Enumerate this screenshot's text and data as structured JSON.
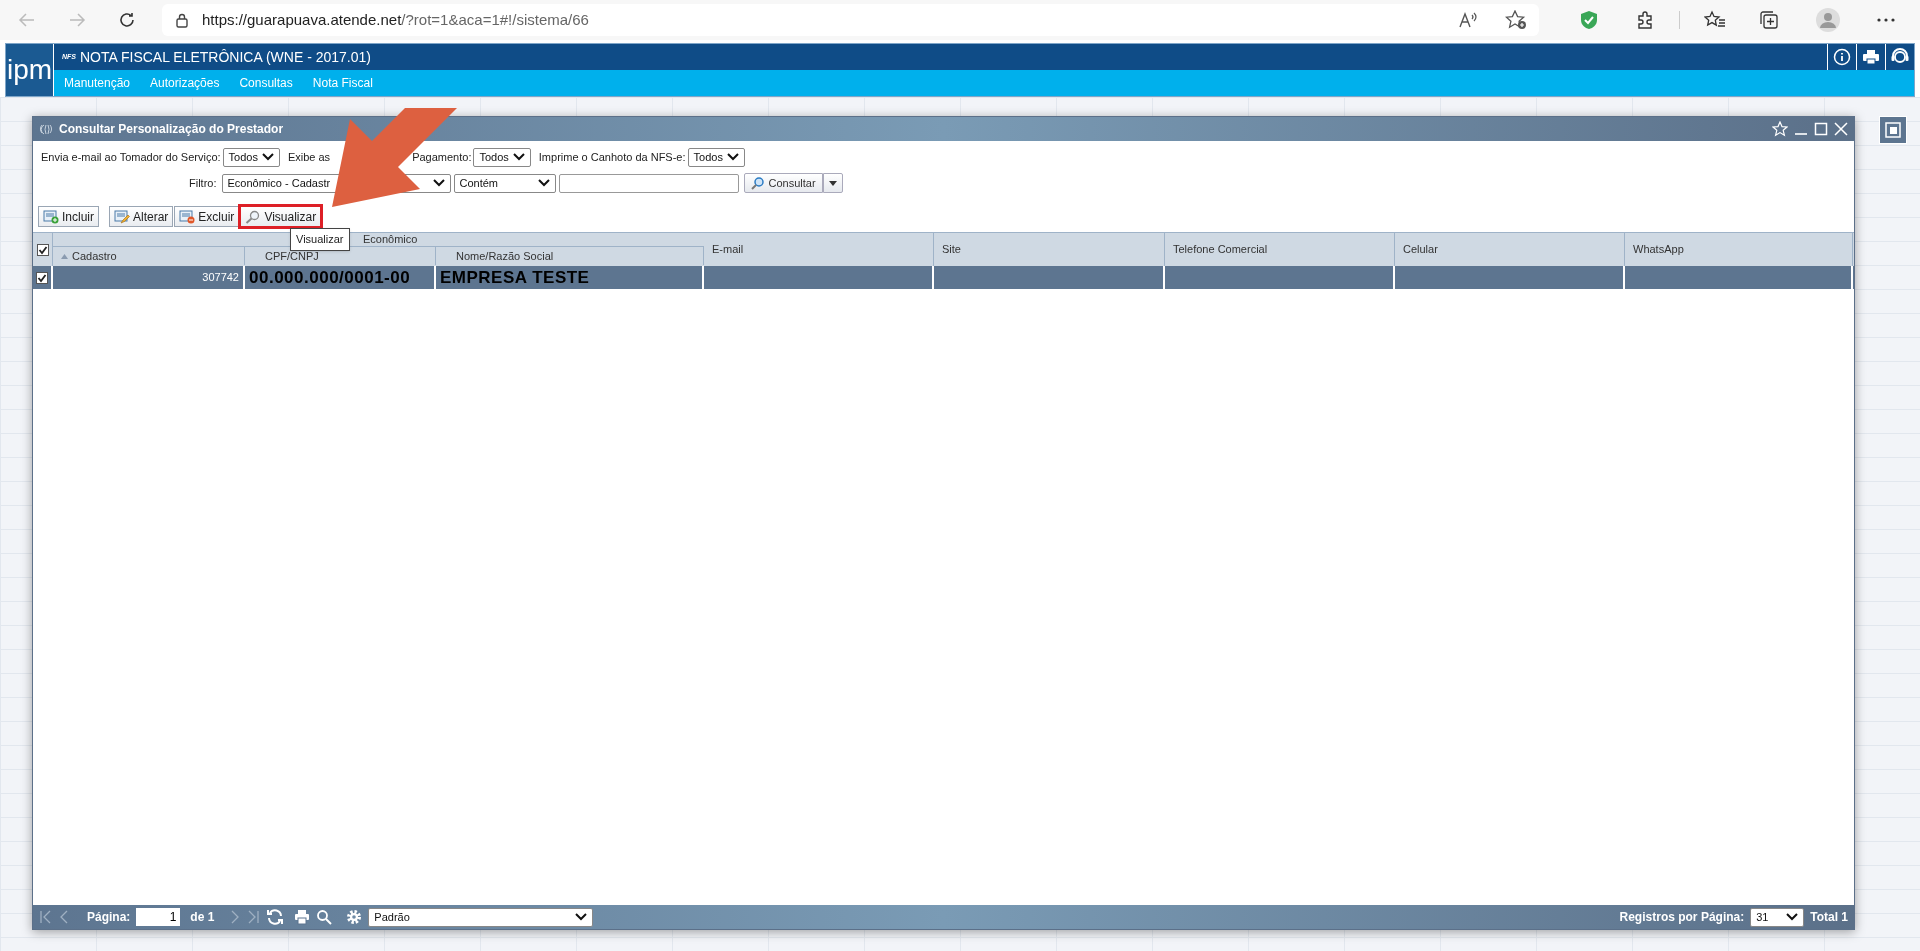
{
  "browser": {
    "url_host": "https://guarapuava.atende.net",
    "url_path": "/?rot=1&aca=1#!/sistema/66"
  },
  "app": {
    "logo": "ipm",
    "badge": "NFS",
    "title": "NOTA FISCAL ELETRÔNICA (WNE - 2017.01)",
    "menu": [
      "Manutenção",
      "Autorizações",
      "Consultas",
      "Nota Fiscal"
    ]
  },
  "window": {
    "title": "Consultar Personalização do Prestador"
  },
  "filters": [
    {
      "label_parts": [
        "Envia e-mail ao Tomador do Serviço:"
      ],
      "value": "Todos"
    },
    {
      "label_parts": [
        "Exibe as",
        "Pagamento:"
      ],
      "value": "Todos"
    },
    {
      "label_parts": [
        "Imprime o Canhoto da NFS-e:"
      ],
      "value": "Todos"
    }
  ],
  "search": {
    "label": "Filtro:",
    "field": "Econômico - Cadastr",
    "operator": "Contém",
    "button": "Consultar"
  },
  "toolbar": [
    {
      "label": "Incluir",
      "kind": "add",
      "highlighted": false
    },
    {
      "label": "Alterar",
      "kind": "edit",
      "highlighted": false
    },
    {
      "label": "Excluir",
      "kind": "delete",
      "highlighted": false
    },
    {
      "label": "Visualizar",
      "kind": "view",
      "highlighted": true
    }
  ],
  "tooltip": "Visualizar",
  "table": {
    "group": "Econômico",
    "all_checked": true,
    "grouped_columns": [
      {
        "label": "Cadastro",
        "sorted": true
      },
      {
        "label": "CPF/CNPJ",
        "sorted": false
      },
      {
        "label": "Nome/Razão Social",
        "sorted": false
      }
    ],
    "columns": [
      {
        "label": "E-mail",
        "sorted": false
      },
      {
        "label": "Site",
        "sorted": false
      },
      {
        "label": "Telefone Comercial",
        "sorted": false
      },
      {
        "label": "Celular",
        "sorted": false
      },
      {
        "label": "WhatsApp",
        "sorted": false
      }
    ],
    "rows": [
      {
        "checked": true,
        "selected": true,
        "cells": [
          "307742",
          "00.000.000/0001-00",
          "EMPRESA TESTE"
        ]
      }
    ]
  },
  "pager": {
    "label": "Página:",
    "page": "1",
    "of": "de 1",
    "layout": "Padrão",
    "per_page_label": "Registros por Página:",
    "per_page": "31",
    "total": "Total 1"
  }
}
